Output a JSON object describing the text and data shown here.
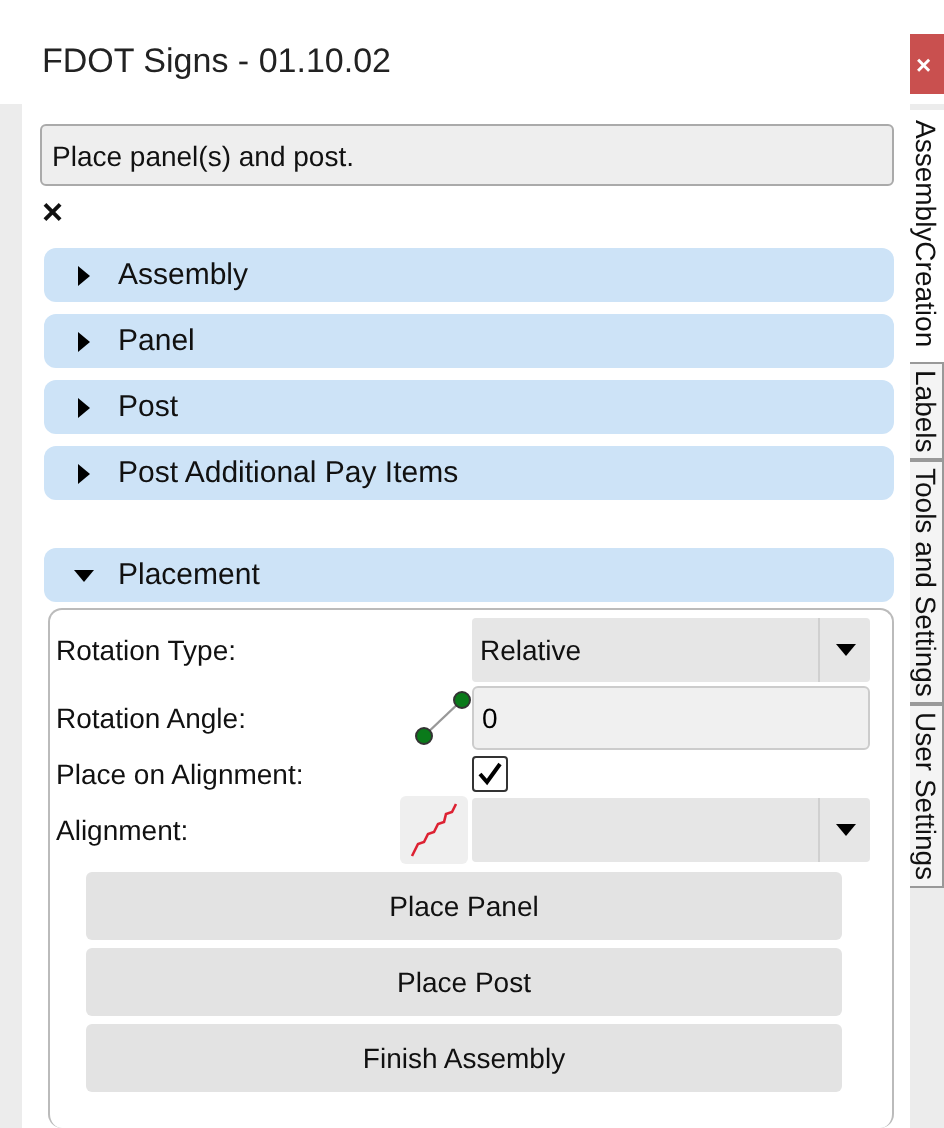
{
  "window": {
    "title": "FDOT Signs - 01.10.02",
    "close": "×"
  },
  "prompt": "Place panel(s) and post.",
  "dismiss": "×",
  "sections": [
    {
      "label": "Assembly",
      "expanded": false
    },
    {
      "label": "Panel",
      "expanded": false
    },
    {
      "label": "Post",
      "expanded": false
    },
    {
      "label": "Post Additional Pay Items",
      "expanded": false
    },
    {
      "label": "Placement",
      "expanded": true
    }
  ],
  "placement": {
    "rotation_type": {
      "label": "Rotation Type:",
      "value": "Relative"
    },
    "rotation_angle": {
      "label": "Rotation Angle:",
      "value": "0"
    },
    "place_on_alignment": {
      "label": "Place on Alignment:",
      "checked": true
    },
    "alignment": {
      "label": "Alignment:"
    },
    "buttons": [
      "Place Panel",
      "Place Post",
      "Finish Assembly"
    ]
  },
  "side_tabs": [
    {
      "label": "AssemblyCreation",
      "selected": true
    },
    {
      "label": "Labels",
      "selected": false
    },
    {
      "label": "Tools and Settings",
      "selected": false
    },
    {
      "label": "User Settings",
      "selected": false
    }
  ]
}
